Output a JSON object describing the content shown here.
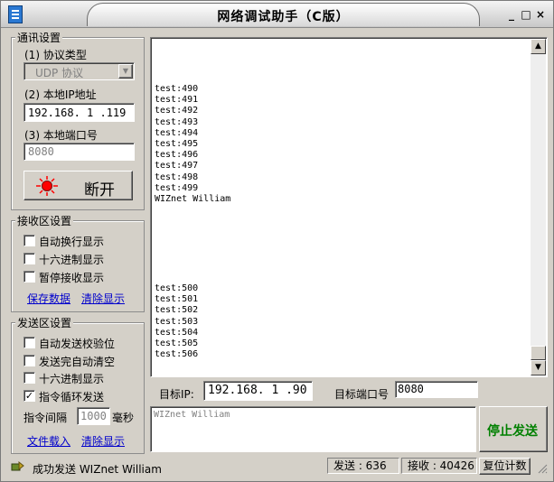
{
  "window": {
    "title": "网络调试助手（C版）",
    "minimize": "_",
    "maximize": "□",
    "close": "×"
  },
  "comm_settings": {
    "title": "通讯设置",
    "protocol_label": "(1) 协议类型",
    "protocol_value": "UDP 协议",
    "local_ip_label": "(2) 本地IP地址",
    "local_ip_value": "192.168. 1 .119",
    "local_port_label": "(3) 本地端口号",
    "local_port_value": "8080",
    "disconnect_label": "断开"
  },
  "receive_settings": {
    "title": "接收区设置",
    "options": [
      {
        "label": "自动换行显示",
        "checked": false
      },
      {
        "label": "十六进制显示",
        "checked": false
      },
      {
        "label": "暂停接收显示",
        "checked": false
      }
    ],
    "save_link": "保存数据",
    "clear_link": "清除显示"
  },
  "send_settings": {
    "title": "发送区设置",
    "options": [
      {
        "label": "自动发送校验位",
        "checked": false
      },
      {
        "label": "发送完自动清空",
        "checked": false
      },
      {
        "label": "十六进制显示",
        "checked": false
      },
      {
        "label": "指令循环发送",
        "checked": true
      }
    ],
    "interval_label": "指令间隔",
    "interval_value": "1000",
    "interval_unit": "毫秒",
    "file_link": "文件载入",
    "clear_link": "清除显示"
  },
  "receive_log": {
    "block1": [
      "test:490",
      "test:491",
      "test:492",
      "test:493",
      "test:494",
      "test:495",
      "test:496",
      "test:497",
      "test:498",
      "test:499",
      "WIZnet William"
    ],
    "block2": [
      "test:500",
      "test:501",
      "test:502",
      "test:503",
      "test:504",
      "test:505",
      "test:506"
    ]
  },
  "target": {
    "ip_label": "目标IP:",
    "ip_value": "192.168. 1 .90",
    "port_label": "目标端口号",
    "port_value": "8080"
  },
  "send_box": {
    "text": "WIZnet William",
    "stop_label": "停止发送"
  },
  "status": {
    "message": "成功发送 WIZnet William",
    "sent_label": "发送 : 636",
    "recv_label": "接收 : 40426",
    "reset_label": "复位计数"
  },
  "colors": {
    "window_bg": "#d4d0c8",
    "link": "#0000cc",
    "stop_text": "#008000",
    "led": "#ff0000"
  }
}
